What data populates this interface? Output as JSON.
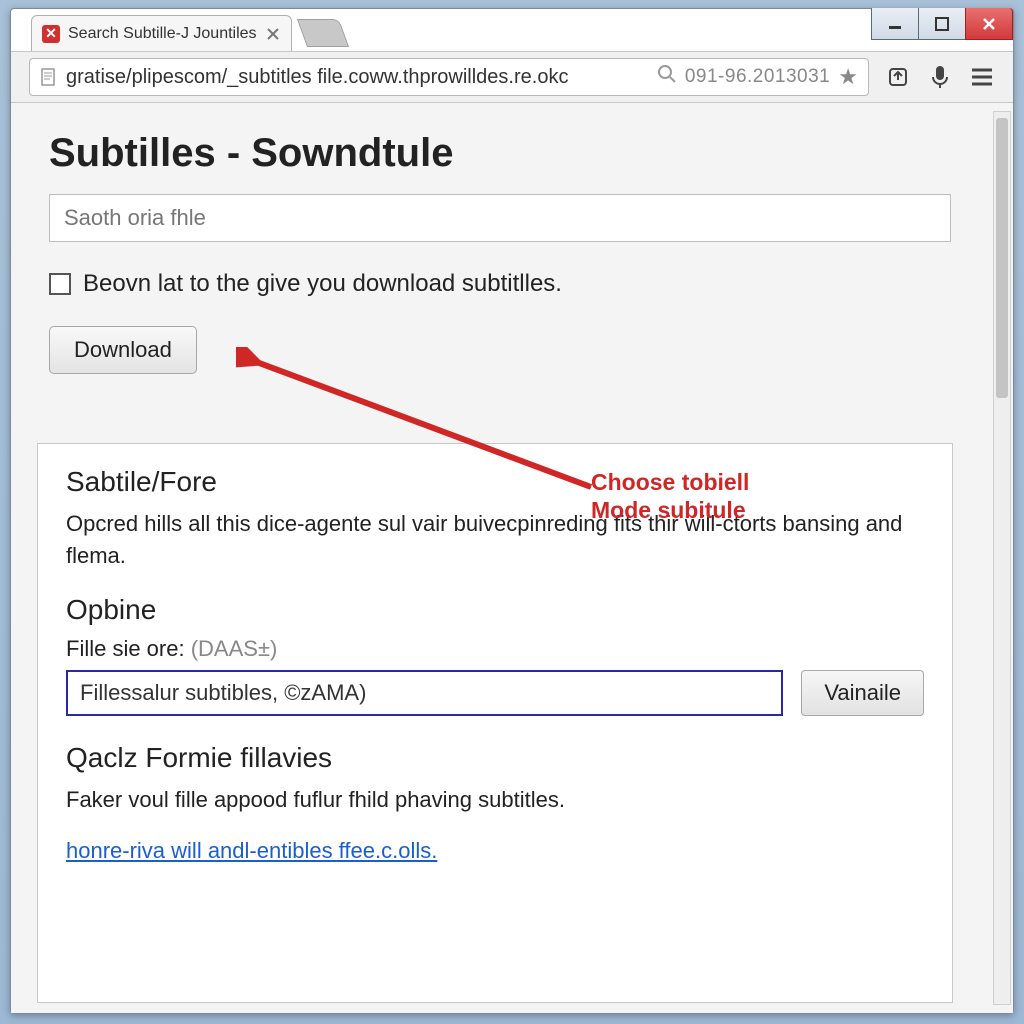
{
  "window": {
    "tab_title": "Search Subtille-J Jountiles",
    "url_text": "gratise/plipescom/_subtitles file.coww.thprowilldes.re.okc",
    "url_suffix": "091-96.2013031"
  },
  "page": {
    "heading": "Subtilles - Sowndtule",
    "search_placeholder": "Saoth oria fhle",
    "checkbox_label": "Beovn lat to the give you download subtitlles.",
    "download_label": "Download"
  },
  "annotation": {
    "line1": "Choose tobiell",
    "line2": "Mode subitule"
  },
  "panel": {
    "h1": "Sabtile/Fore",
    "p1": "Opcred hills all this dice-agente sul vair buivecpinreding fits thir will-ctorts bansing and flema.",
    "h2": "Opbine",
    "label": "Fille sie ore:",
    "label_hint": "(DAAS±)",
    "input_value": "Fillessalur subtibles, ©zAMA)",
    "side_button": "Vainaile",
    "h3": "Qaclz Formie fillavies",
    "p3": "Faker voul fille appood fuflur fhild phaving subtitles.",
    "link": "honre-riva will andl-entibles ffee.c.olls."
  }
}
